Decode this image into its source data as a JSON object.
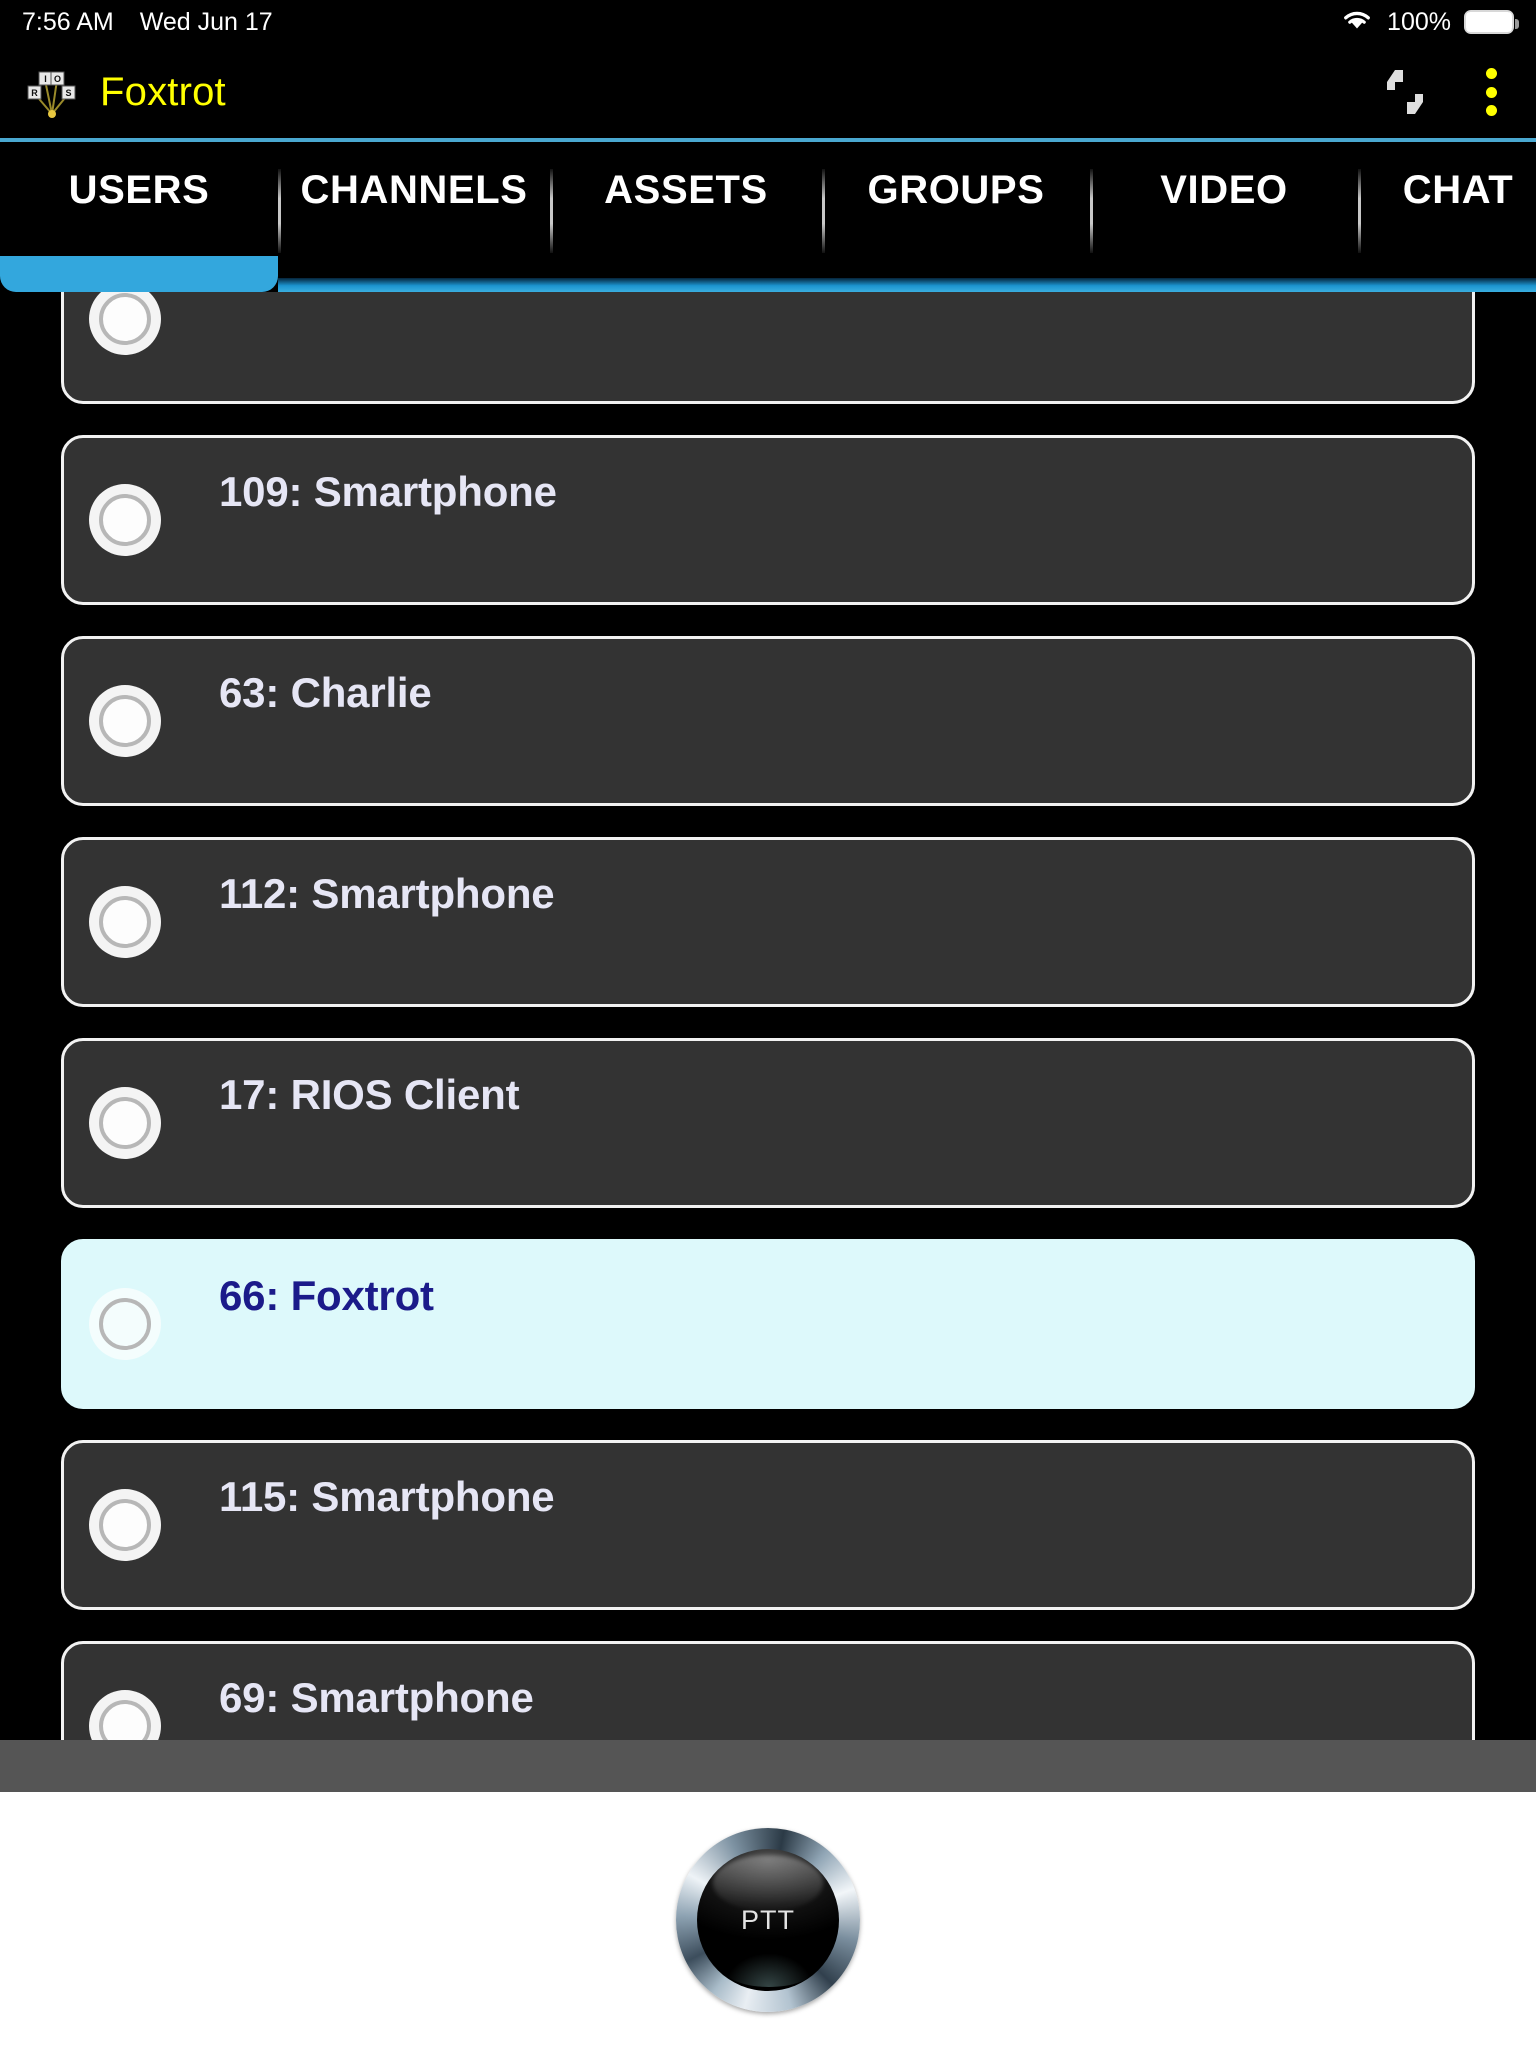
{
  "status_bar": {
    "time": "7:56 AM",
    "date": "Wed Jun 17",
    "wifi_icon": "wifi-icon",
    "battery_percent": "100%",
    "battery_icon": "battery-full-icon"
  },
  "app_bar": {
    "logo_icon": "rios-logo-icon",
    "title": "Foxtrot",
    "transfer_icon": "up-down-arrows-icon",
    "overflow_icon": "kebab-menu-icon",
    "accent_color": "#ffff00",
    "rule_color": "#4aa8d0"
  },
  "tabs": {
    "active_index": 0,
    "active_underline_color": "#33a7dd",
    "items": [
      {
        "label": "USERS"
      },
      {
        "label": "CHANNELS"
      },
      {
        "label": "ASSETS"
      },
      {
        "label": "GROUPS"
      },
      {
        "label": "VIDEO"
      },
      {
        "label": "CHAT"
      }
    ]
  },
  "list": {
    "selected_bg": "#ddf9fb",
    "selected_fg": "#1b1b8a",
    "row_bg": "#333333",
    "row_fg": "#e6e6f5",
    "rows": [
      {
        "label": "",
        "selected": false,
        "partial": true
      },
      {
        "label": "109: Smartphone",
        "selected": false
      },
      {
        "label": "63: Charlie",
        "selected": false
      },
      {
        "label": "112: Smartphone",
        "selected": false
      },
      {
        "label": "17: RIOS Client",
        "selected": false
      },
      {
        "label": "66: Foxtrot",
        "selected": true
      },
      {
        "label": "115: Smartphone",
        "selected": false
      },
      {
        "label": "69: Smartphone",
        "selected": false
      }
    ]
  },
  "ptt": {
    "label": "PTT"
  }
}
